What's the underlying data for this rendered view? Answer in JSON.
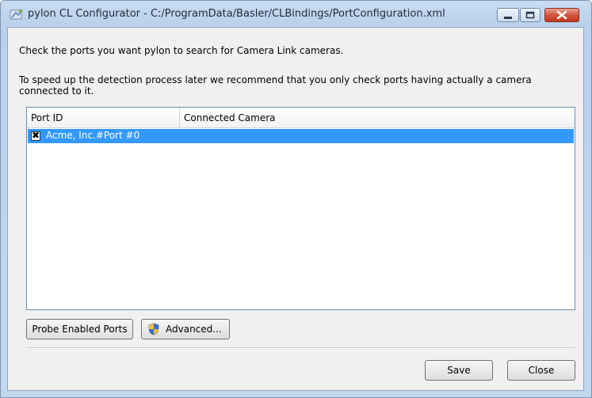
{
  "window": {
    "title": "pylon CL Configurator - C:/ProgramData/Basler/CLBindings/PortConfiguration.xml"
  },
  "instructions": {
    "line1": "Check the ports you want pylon to search for Camera Link cameras.",
    "line2": "To speed up the detection process later we recommend that you only check ports having actually a camera connected to it."
  },
  "table": {
    "columns": [
      "Port ID",
      "Connected Camera"
    ],
    "rows": [
      {
        "checked": true,
        "port_id": "Acme, Inc.#Port #0",
        "camera": ""
      }
    ]
  },
  "buttons": {
    "probe": "Probe Enabled Ports",
    "advanced": "Advanced...",
    "save": "Save",
    "close": "Close"
  },
  "icons": {
    "app": "pylon-configurator-icon",
    "advanced": "uac-shield-icon",
    "minimize": "minimize-icon",
    "maximize": "maximize-icon",
    "close": "close-icon"
  }
}
